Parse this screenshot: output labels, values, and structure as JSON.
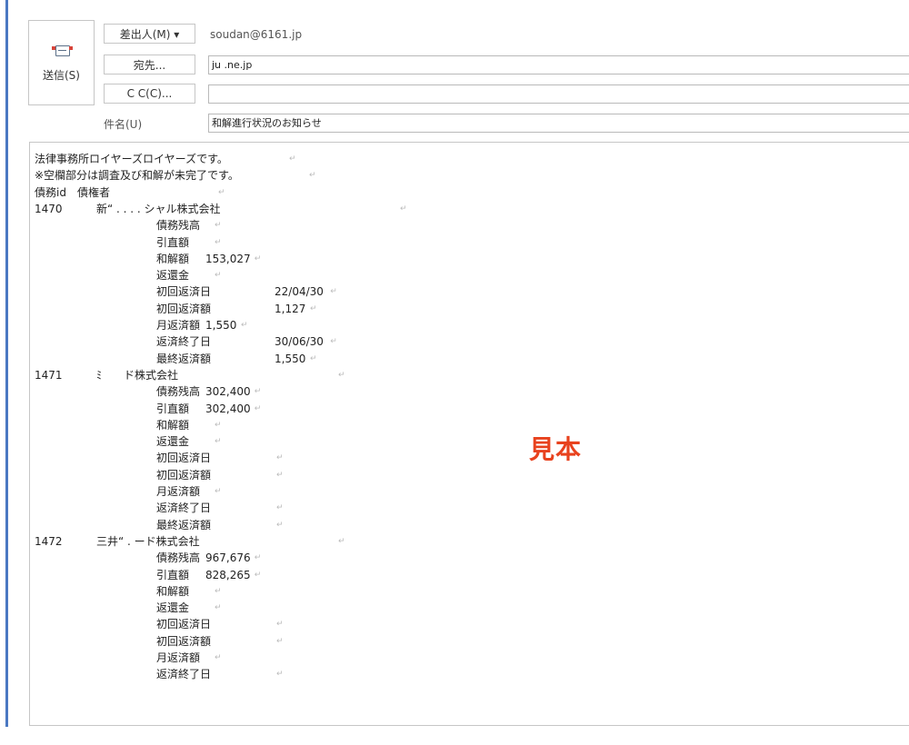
{
  "window": {
    "send_label": "送信(S)",
    "from_button": "差出人(M) ▾",
    "from_value": "soudan@6161.jp",
    "to_button": "宛先...",
    "to_value": "ju                    .ne.jp",
    "cc_button": "C C(C)...",
    "cc_value": "",
    "subject_label": "件名(U)",
    "subject_value": "和解進行状況のお知らせ"
  },
  "body": {
    "intro1": "法律事務所ロイヤーズロイヤーズです。",
    "intro2": "※空欄部分は調査及び和解が未完了です。",
    "header": "債務id　債権者",
    "return_mark": "↵",
    "creditors": [
      {
        "id": "1470",
        "name": "新“ . . . . シャル株式会社",
        "fields": [
          {
            "label": "債務残高",
            "value": ""
          },
          {
            "label": "引直額",
            "value": ""
          },
          {
            "label": "和解額",
            "value": "153,027"
          },
          {
            "label": "返還金",
            "value": ""
          },
          {
            "label": "初回返済日",
            "value": "22/04/30"
          },
          {
            "label": "初回返済額",
            "value": "1,127"
          },
          {
            "label": "月返済額",
            "value": "1,550"
          },
          {
            "label": "返済終了日",
            "value": "30/06/30"
          },
          {
            "label": "最終返済額",
            "value": "1,550"
          }
        ]
      },
      {
        "id": "1471",
        "name": "ﾐ　　ド株式会社",
        "fields": [
          {
            "label": "債務残高",
            "value": "302,400"
          },
          {
            "label": "引直額",
            "value": "302,400"
          },
          {
            "label": "和解額",
            "value": ""
          },
          {
            "label": "返還金",
            "value": ""
          },
          {
            "label": "初回返済日",
            "value": ""
          },
          {
            "label": "初回返済額",
            "value": ""
          },
          {
            "label": "月返済額",
            "value": ""
          },
          {
            "label": "返済終了日",
            "value": ""
          },
          {
            "label": "最終返済額",
            "value": ""
          }
        ]
      },
      {
        "id": "1472",
        "name": "三井“ . ード株式会社",
        "fields": [
          {
            "label": "債務残高",
            "value": "967,676"
          },
          {
            "label": "引直額",
            "value": "828,265"
          },
          {
            "label": "和解額",
            "value": ""
          },
          {
            "label": "返還金",
            "value": ""
          },
          {
            "label": "初回返済日",
            "value": ""
          },
          {
            "label": "初回返済額",
            "value": ""
          },
          {
            "label": "月返済額",
            "value": ""
          },
          {
            "label": "返済終了日",
            "value": ""
          }
        ]
      }
    ]
  },
  "watermark": "見本",
  "colors": {
    "accent": "#4a78c2",
    "watermark": "#e8421e"
  }
}
